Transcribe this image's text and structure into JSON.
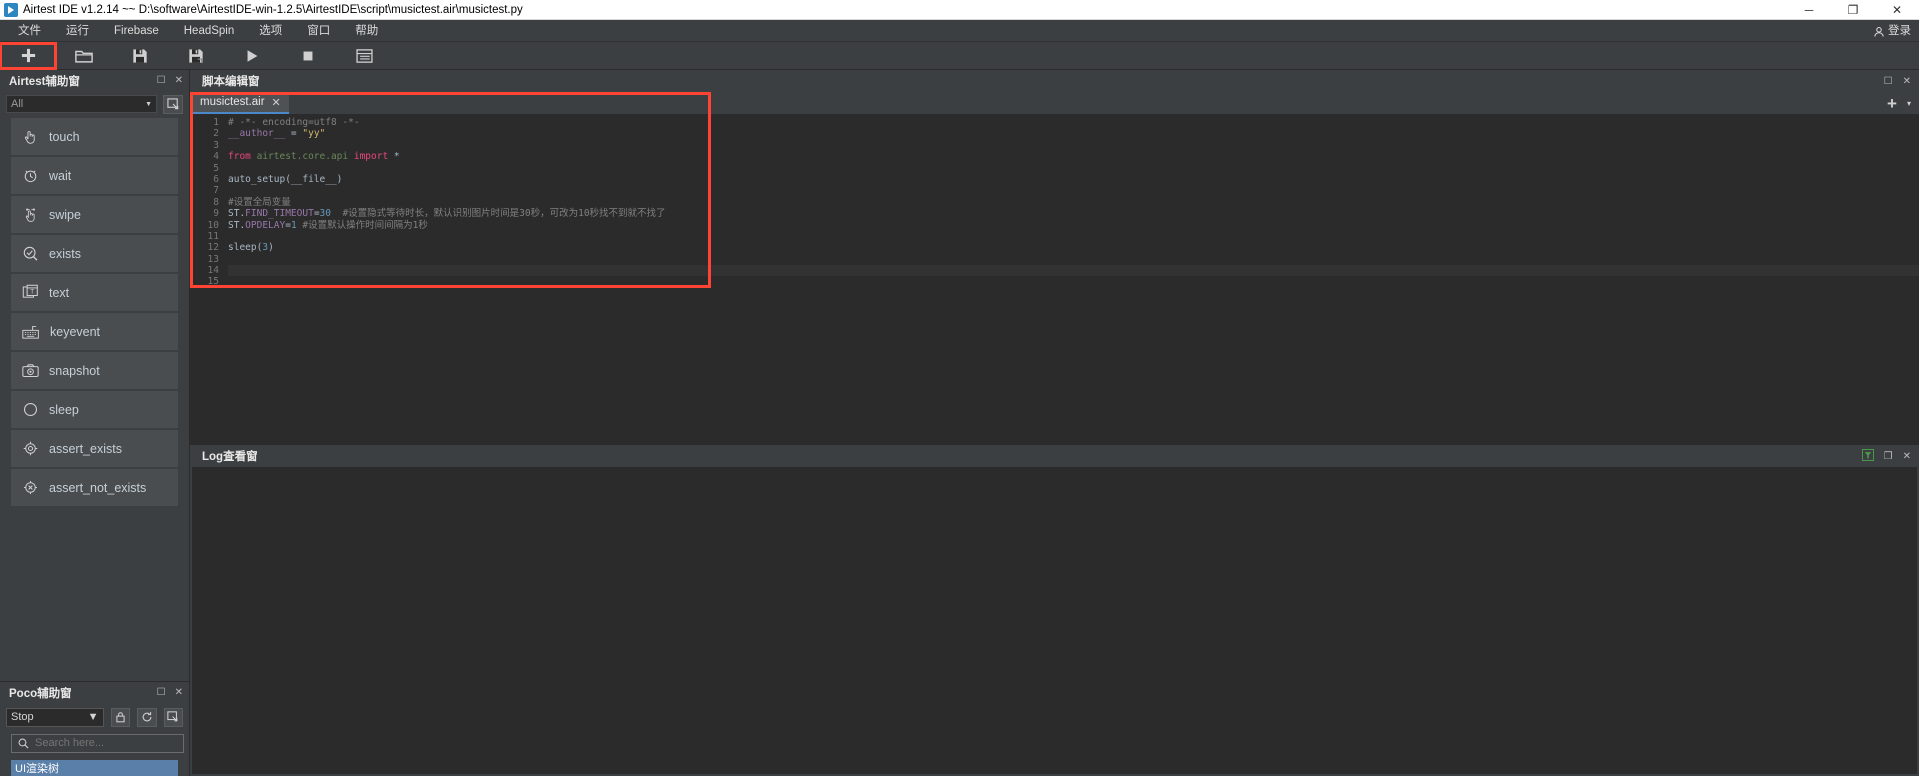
{
  "titlebar": {
    "title": "Airtest IDE v1.2.14 ~~ D:\\software\\AirtestIDE-win-1.2.5\\AirtestIDE\\script\\musictest.air\\musictest.py",
    "minimize": "─",
    "maximize": "❐",
    "close": "✕"
  },
  "menubar": {
    "items": [
      {
        "label": "文件"
      },
      {
        "label": "运行"
      },
      {
        "label": "Firebase"
      },
      {
        "label": "HeadSpin"
      },
      {
        "label": "选项"
      },
      {
        "label": "窗口"
      },
      {
        "label": "帮助"
      }
    ],
    "login_label": "登录"
  },
  "toolbar": {
    "buttons": [
      {
        "name": "new-script-button",
        "icon": "plus-icon",
        "highlighted": true
      },
      {
        "name": "open-script-button",
        "icon": "folder-icon",
        "highlighted": false
      },
      {
        "name": "save-script-button",
        "icon": "save-icon",
        "highlighted": false
      },
      {
        "name": "save-as-script-button",
        "icon": "save-as-icon",
        "highlighted": false
      },
      {
        "name": "run-script-button",
        "icon": "play-icon",
        "highlighted": false
      },
      {
        "name": "stop-script-button",
        "icon": "stop-icon",
        "highlighted": false
      },
      {
        "name": "view-report-button",
        "icon": "report-icon",
        "highlighted": false
      }
    ]
  },
  "airtest_panel": {
    "title": "Airtest辅助窗",
    "filter": {
      "value": "All",
      "placeholder": "All"
    },
    "snapshot_button": "screen-capture-icon",
    "items": [
      {
        "label": "touch",
        "icon": "touch-hand-icon"
      },
      {
        "label": "wait",
        "icon": "alarm-clock-icon"
      },
      {
        "label": "swipe",
        "icon": "swipe-hand-icon"
      },
      {
        "label": "exists",
        "icon": "check-circle-icon"
      },
      {
        "label": "text",
        "icon": "text-window-icon"
      },
      {
        "label": "keyevent",
        "icon": "keyboard-icon"
      },
      {
        "label": "snapshot",
        "icon": "camera-icon"
      },
      {
        "label": "sleep",
        "icon": "moon-icon"
      },
      {
        "label": "assert_exists",
        "icon": "target-icon"
      },
      {
        "label": "assert_not_exists",
        "icon": "target-x-icon"
      }
    ]
  },
  "poco_panel": {
    "title": "Poco辅助窗",
    "mode": {
      "value": "Stop"
    },
    "search": {
      "value": "",
      "placeholder": "Search here..."
    },
    "tree_tab": "UI渲染树"
  },
  "editor_panel": {
    "title": "脚本编辑窗",
    "tab": {
      "label": "musictest.air",
      "close": "✕"
    },
    "add_tab": "+",
    "more_tabs": "▾",
    "code_lines": [
      {
        "n": 1,
        "tokens": [
          {
            "t": "# -*- encoding=utf8 -*-",
            "c": "tok-comment"
          }
        ]
      },
      {
        "n": 2,
        "tokens": [
          {
            "t": "__author__ ",
            "c": "tok-const"
          },
          {
            "t": "= ",
            "c": "tok-plain"
          },
          {
            "t": "\"yy\"",
            "c": "tok-str"
          }
        ]
      },
      {
        "n": 3,
        "tokens": []
      },
      {
        "n": 4,
        "tokens": [
          {
            "t": "from ",
            "c": "tok-kw2"
          },
          {
            "t": "airtest.core.api ",
            "c": "tok-green"
          },
          {
            "t": "import ",
            "c": "tok-kw2"
          },
          {
            "t": "*",
            "c": "tok-plain"
          }
        ]
      },
      {
        "n": 5,
        "tokens": []
      },
      {
        "n": 6,
        "tokens": [
          {
            "t": "auto_setup(__file__)",
            "c": "tok-plain"
          }
        ]
      },
      {
        "n": 7,
        "tokens": []
      },
      {
        "n": 8,
        "tokens": [
          {
            "t": "#设置全局变量",
            "c": "tok-comment"
          }
        ]
      },
      {
        "n": 9,
        "tokens": [
          {
            "t": "ST.",
            "c": "tok-plain"
          },
          {
            "t": "FIND_TIMEOUT",
            "c": "tok-const"
          },
          {
            "t": "=",
            "c": "tok-plain"
          },
          {
            "t": "30",
            "c": "tok-num"
          },
          {
            "t": "  #设置隐式等待时长，默认识别图片时间是30秒，可改为10秒找不到就不找了",
            "c": "tok-comment"
          }
        ]
      },
      {
        "n": 10,
        "tokens": [
          {
            "t": "ST.",
            "c": "tok-plain"
          },
          {
            "t": "OPDELAY",
            "c": "tok-const"
          },
          {
            "t": "=",
            "c": "tok-plain"
          },
          {
            "t": "1",
            "c": "tok-num"
          },
          {
            "t": " #设置默认操作时间间隔为1秒",
            "c": "tok-comment"
          }
        ]
      },
      {
        "n": 11,
        "tokens": []
      },
      {
        "n": 12,
        "tokens": [
          {
            "t": "sleep(",
            "c": "tok-plain"
          },
          {
            "t": "3",
            "c": "tok-num"
          },
          {
            "t": ")",
            "c": "tok-plain"
          }
        ]
      },
      {
        "n": 13,
        "tokens": []
      },
      {
        "n": 14,
        "tokens": [],
        "current": true
      },
      {
        "n": 15,
        "tokens": []
      }
    ]
  },
  "log_panel": {
    "title": "Log查看窗",
    "filter_icon": "filter-icon",
    "maximize": "❐",
    "close": "✕"
  },
  "colors": {
    "accent_red": "#ff4433",
    "tab_underline": "#4a88c7",
    "panel_bg": "#3c3f41",
    "editor_bg": "#2b2b2b",
    "item_bg": "#4a4d4f"
  }
}
